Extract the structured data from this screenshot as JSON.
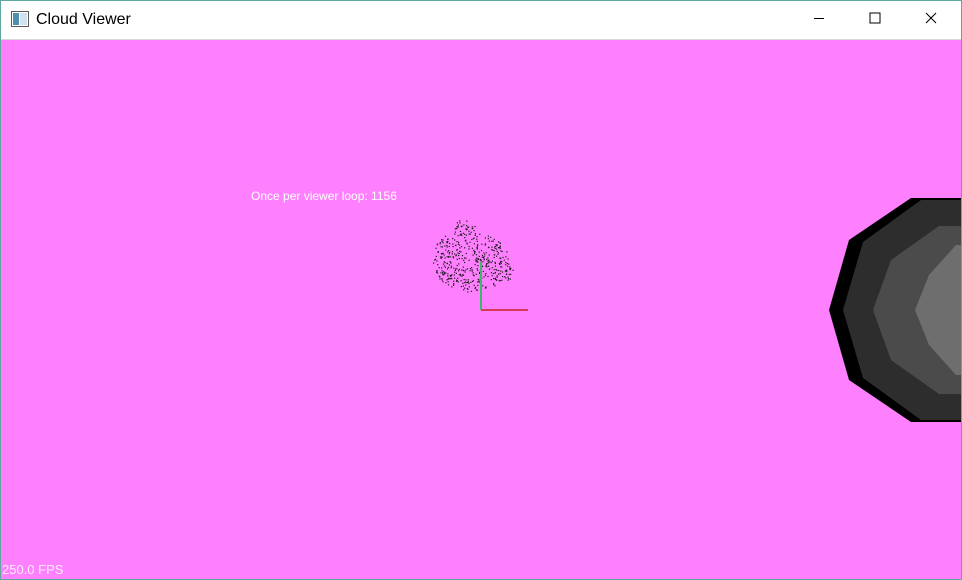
{
  "window": {
    "title": "Cloud Viewer",
    "icon": "app-window-icon",
    "controls": {
      "minimize_icon": "minimize-icon",
      "maximize_icon": "maximize-icon",
      "close_icon": "close-icon"
    }
  },
  "viewer": {
    "background_color": "#ff80ff",
    "loop_label": "Once per viewer loop: 1156",
    "fps_label": "250.0 FPS",
    "axis_colors": {
      "x": "#d43a5a",
      "y": "#3bb86a"
    },
    "point_color": "#1a1a1a",
    "object_shades": [
      "#000000",
      "#2d2d2d",
      "#4b4b4b",
      "#6e6e6e"
    ]
  }
}
